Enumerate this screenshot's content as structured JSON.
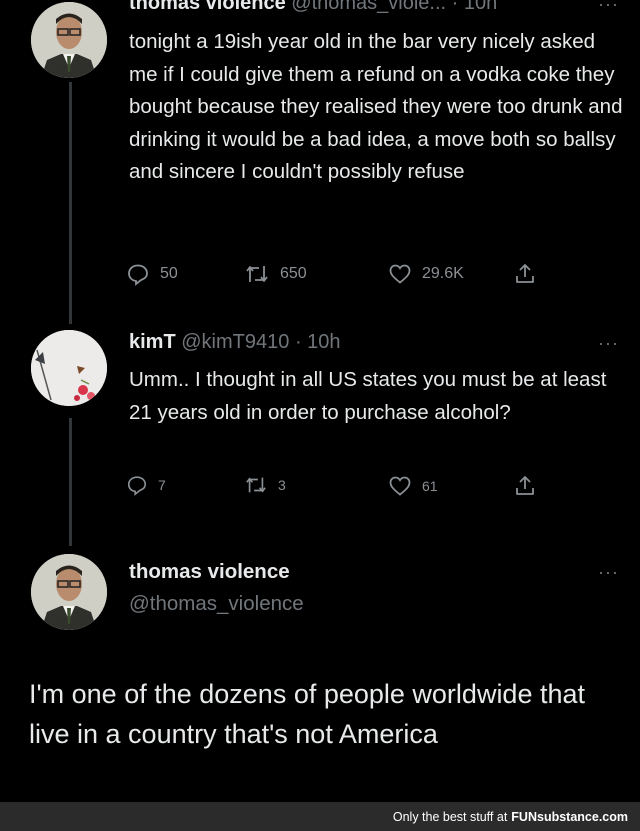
{
  "tweet1": {
    "name": "thomas violence",
    "handle": "@thomas_viole...",
    "time": "· 10h",
    "text": "tonight a 19ish year old in the bar very nicely asked me if I could give them a refund on a vodka coke they bought because they realised they were too drunk and drinking it would be a bad idea, a move both so ballsy and sincere I couldn't possibly refuse",
    "replies": "50",
    "retweets": "650",
    "likes": "29.6K"
  },
  "tweet2": {
    "name": "kimT",
    "handle": "@kimT9410",
    "time": "· 10h",
    "text": "Umm.. I thought in all US states you must be at least 21 years old in order to purchase alcohol?",
    "replies": "7",
    "retweets": "3",
    "likes": "61"
  },
  "tweet3": {
    "name": "thomas violence",
    "handle": "@thomas_violence",
    "text": "I'm one of the dozens of people worldwide that live in a country that's not America"
  },
  "more_glyph": "···",
  "footer": {
    "prefix": "Only the best stuff at",
    "brand": "FUNsubstance.com"
  },
  "colors": {
    "background": "#000000",
    "text": "#e7e9ea",
    "secondary": "#71767b",
    "thread_line": "#333639",
    "footer_bg": "#2b2b2b"
  }
}
